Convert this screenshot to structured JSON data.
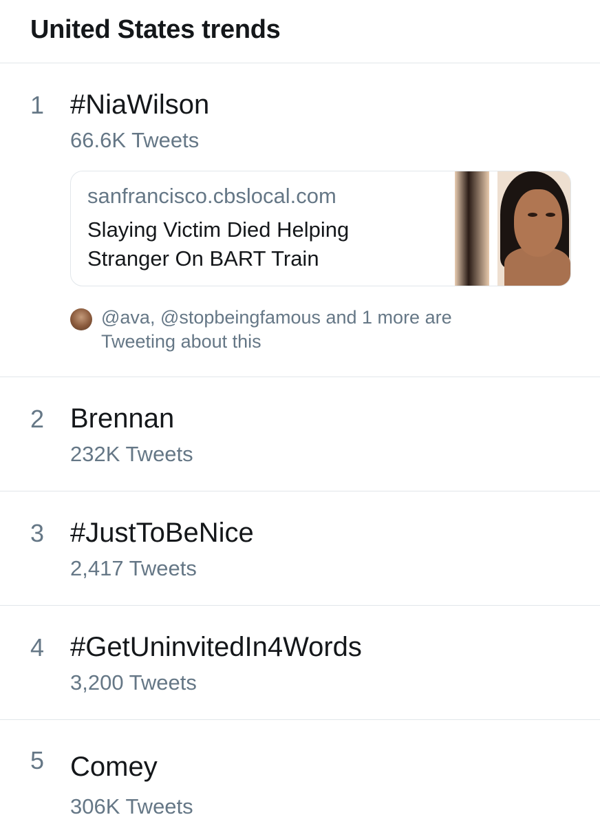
{
  "header": {
    "title": "United States trends"
  },
  "trends": [
    {
      "rank": "1",
      "name": "#NiaWilson",
      "count": "66.6K Tweets",
      "card": {
        "domain": "sanfrancisco.cbslocal.com",
        "headline": "Slaying Victim Died Helping Stranger On BART Train"
      },
      "social": {
        "line1": "@ava, @stopbeingfamous and 1 more are",
        "line2": "Tweeting about this"
      }
    },
    {
      "rank": "2",
      "name": "Brennan",
      "count": "232K Tweets"
    },
    {
      "rank": "3",
      "name": "#JustToBeNice",
      "count": "2,417 Tweets"
    },
    {
      "rank": "4",
      "name": "#GetUninvitedIn4Words",
      "count": "3,200 Tweets"
    },
    {
      "rank": "5",
      "name": "Comey",
      "count": "306K Tweets"
    }
  ],
  "colors": {
    "primary_text": "#14171a",
    "secondary_text": "#657786",
    "divider": "#e1e6ea"
  }
}
